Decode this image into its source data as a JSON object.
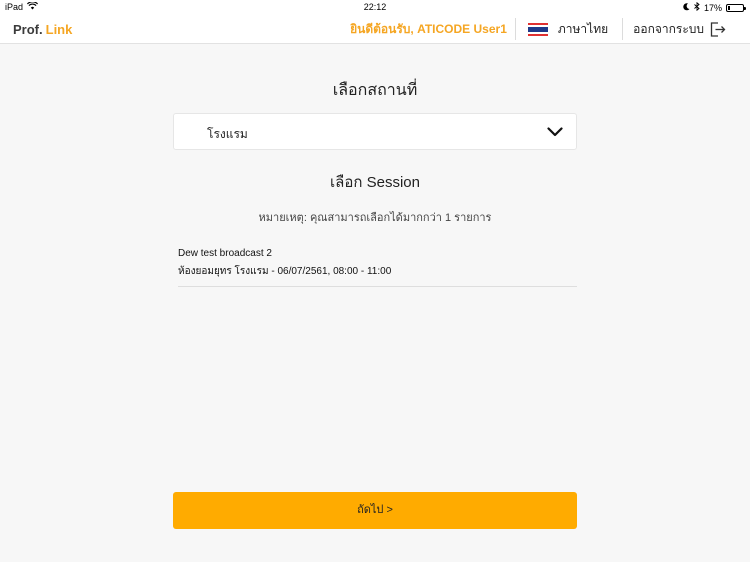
{
  "status_bar": {
    "device": "iPad",
    "time": "22:12",
    "battery": "17%",
    "battery_level": 0.17
  },
  "header": {
    "brand_prof": "Prof.",
    "brand_link": "Link",
    "welcome": "ยินดีต้อนรับ, ATICODE User1",
    "language": "ภาษาไทย",
    "logout": "ออกจากระบบ"
  },
  "location": {
    "title": "เลือกสถานที่",
    "selected": "โรงแรม"
  },
  "session": {
    "title": "เลือก Session",
    "note": "หมายเหตุ: คุณสามารถเลือกได้มากกว่า 1 รายการ",
    "items": [
      {
        "name": "Dew test broadcast 2",
        "details": "ห้องยอมยุทร โรงแรม - 06/07/2561, 08:00 - 11:00"
      }
    ]
  },
  "next_button": "ถัดไป >",
  "colors": {
    "accent": "#f5a623",
    "button": "#ffab00",
    "background": "#f7f7f7"
  }
}
